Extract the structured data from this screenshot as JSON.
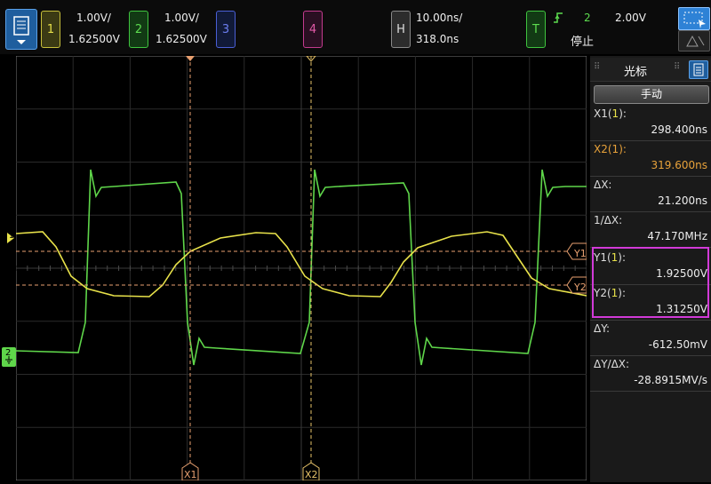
{
  "topbar": {
    "ch1": {
      "num": "1",
      "scale": "1.00V/",
      "offset": "1.62500V"
    },
    "ch2": {
      "num": "2",
      "scale": "1.00V/",
      "offset": "1.62500V"
    },
    "ch3": {
      "num": "3"
    },
    "ch4": {
      "num": "4"
    },
    "horizontal": {
      "badge": "H",
      "timebase": "10.00ns/",
      "delay": "318.0ns"
    },
    "trigger": {
      "badge": "T",
      "source": "2",
      "level": "2.00V",
      "status": "停止"
    }
  },
  "panel": {
    "title": "光标",
    "mode_button": "手动",
    "x1_label": "X1(",
    "x1_ch": "1",
    "x1_close": "):",
    "x1_value": "298.400ns",
    "x2_label": "X2(",
    "x2_ch": "1",
    "x2_close": "):",
    "x2_value": "319.600ns",
    "dx_label": "ΔX:",
    "dx_value": "21.200ns",
    "inv_dx_label": "1/ΔX:",
    "inv_dx_value": "47.170MHz",
    "y1_label": "Y1(",
    "y1_ch": "1",
    "y1_close": "):",
    "y1_value": "1.92500V",
    "y2_label": "Y2(",
    "y2_ch": "1",
    "y2_close": "):",
    "y2_value": "1.31250V",
    "dy_label": "ΔY:",
    "dy_value": "-612.50mV",
    "dydx_label": "ΔY/ΔX:",
    "dydx_value": "-28.8915MV/s"
  },
  "markers": {
    "x1": "X1",
    "x2": "X2",
    "y1": "Y1",
    "y2": "Y2",
    "ch1_marker": "1",
    "ch2_marker": "2"
  },
  "colors": {
    "ch1": "#e8e24a",
    "ch2": "#5fd64a",
    "cursor_x1": "#e8a070",
    "cursor_x2": "#e8c46a",
    "highlight": "#d23ad8",
    "grid": "#2a2a2a"
  }
}
